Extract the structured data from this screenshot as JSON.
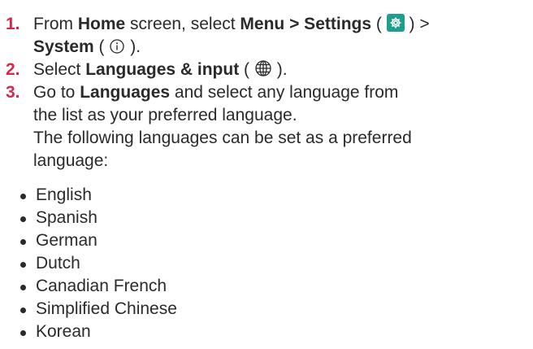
{
  "steps": [
    {
      "number": "1.",
      "line1": {
        "t1": "From ",
        "b1": "Home",
        "t2": " screen, select ",
        "b2": "Menu > Settings",
        "t3": " ( ",
        "t4": " ) >"
      },
      "line2": {
        "b1": "System",
        "t1": " ( ",
        "t2": " )."
      },
      "icons": [
        "settings-gear-icon",
        "info-icon"
      ]
    },
    {
      "number": "2.",
      "line1": {
        "t1": "Select ",
        "b1": "Languages & input",
        "t2": " ( ",
        "t3": " )."
      },
      "icons": [
        "globe-icon"
      ]
    },
    {
      "number": "3.",
      "line1": {
        "t1": "Go to ",
        "b1": "Languages",
        "t2": " and select any language from"
      },
      "line2": "the list as your preferred language.",
      "line3": "The following languages can be set as a preferred",
      "line4": "language:"
    }
  ],
  "languages": [
    "English",
    "Spanish",
    "German",
    "Dutch",
    "Canadian French",
    "Simplified Chinese",
    "Korean"
  ],
  "colors": {
    "step_number": "#d4294e",
    "settings_icon_bg": "#1e9e8c",
    "text": "#2a2a2a"
  }
}
